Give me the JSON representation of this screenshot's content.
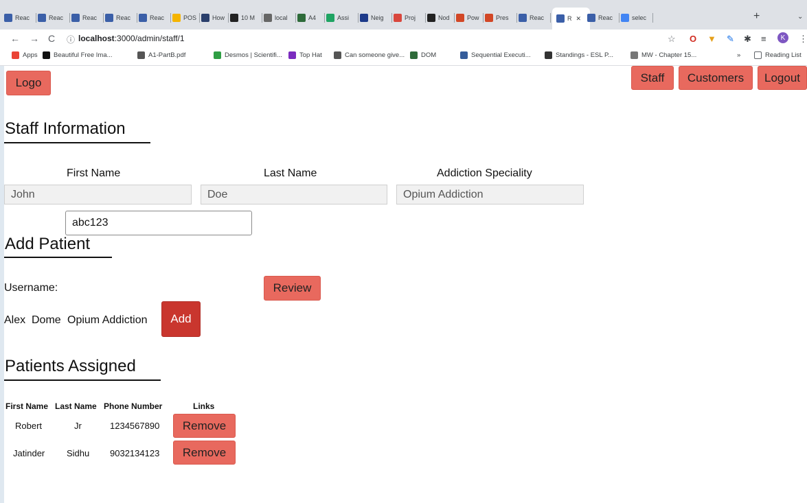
{
  "browser": {
    "tabs": [
      {
        "label": "Reac",
        "color": "#3b5fa8"
      },
      {
        "label": "Reac",
        "color": "#3b5fa8"
      },
      {
        "label": "Reac",
        "color": "#3b5fa8"
      },
      {
        "label": "Reac",
        "color": "#3b5fa8"
      },
      {
        "label": "Reac",
        "color": "#3b5fa8"
      },
      {
        "label": "POS",
        "color": "#f5b400"
      },
      {
        "label": "How",
        "color": "#2a3f6c"
      },
      {
        "label": "10 M",
        "color": "#222"
      },
      {
        "label": "local",
        "color": "#666"
      },
      {
        "label": "A4",
        "color": "#2e6b3a"
      },
      {
        "label": "Assi",
        "color": "#1fa463"
      },
      {
        "label": "Neig",
        "color": "#1d3a8a"
      },
      {
        "label": "Proj",
        "color": "#d9473d"
      },
      {
        "label": "Nod",
        "color": "#222"
      },
      {
        "label": "Pow",
        "color": "#d24726"
      },
      {
        "label": "Pres",
        "color": "#d24726"
      },
      {
        "label": "Reac",
        "color": "#3b5fa8"
      },
      {
        "label": "R",
        "color": "#3b5fa8",
        "active": true
      },
      {
        "label": "Reac",
        "color": "#3b5fa8"
      },
      {
        "label": "selec",
        "color": "#4285f4"
      }
    ],
    "new_tab": "+",
    "url_scheme_icon": "info-icon",
    "url_host": "localhost",
    "url_rest": ":3000/admin/staff/1",
    "bookmarks": [
      {
        "label": "Apps",
        "color": "#ea4335"
      },
      {
        "label": "Beautiful Free Ima...",
        "color": "#111"
      },
      {
        "label": "A1-PartB.pdf",
        "color": "#555"
      },
      {
        "label": "Desmos | Scientifi...",
        "color": "#2f9e44"
      },
      {
        "label": "Top Hat",
        "color": "#7b2cbf"
      },
      {
        "label": "Can someone give...",
        "color": "#555"
      },
      {
        "label": "DOM",
        "color": "#2e6b3a"
      },
      {
        "label": "Sequential Executi...",
        "color": "#355c9a"
      },
      {
        "label": "Standings - ESL P...",
        "color": "#333"
      },
      {
        "label": "MW - Chapter 15...",
        "color": "#777"
      }
    ],
    "bookmarks_more": "»",
    "reading_list": "Reading List",
    "profile_initial": "K"
  },
  "nav": {
    "logo": "Logo",
    "staff": "Staff",
    "customers": "Customers",
    "logout": "Logout"
  },
  "staff_info": {
    "heading": "Staff Information",
    "first_name_label": "First Name",
    "last_name_label": "Last Name",
    "speciality_label": "Addiction Speciality",
    "first_name": "John",
    "last_name": "Doe",
    "speciality": "Opium Addiction"
  },
  "add_patient": {
    "heading": "Add Patient",
    "username_label": "Username:",
    "username_value": "abc123",
    "review": "Review",
    "result_first": "Alex",
    "result_last": "Dome",
    "result_speciality": "Opium Addiction",
    "add": "Add"
  },
  "patients": {
    "heading": "Patients Assigned",
    "columns": [
      "First Name",
      "Last Name",
      "Phone Number",
      "Links"
    ],
    "rows": [
      {
        "first": "Robert",
        "last": "Jr",
        "phone": "1234567890",
        "action": "Remove"
      },
      {
        "first": "Jatinder",
        "last": "Sidhu",
        "phone": "9032134123",
        "action": "Remove"
      }
    ]
  }
}
